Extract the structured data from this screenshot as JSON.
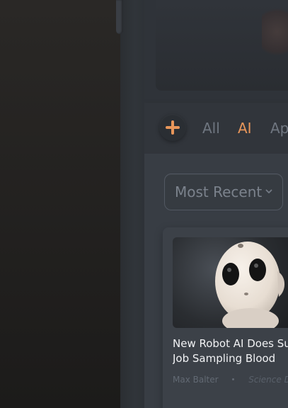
{
  "tabs": {
    "items": [
      {
        "label": "All",
        "active": false
      },
      {
        "label": "AI",
        "active": true
      },
      {
        "label": "Ap",
        "active": false
      }
    ],
    "accent_color": "#e8965a"
  },
  "sort": {
    "selected": "Most Recent"
  },
  "card": {
    "title_line1": "New Robot AI Does Sup",
    "title_line2": "Job Sampling Blood",
    "author": "Max Balter",
    "source": "Science Do"
  },
  "icons": {
    "add": "plus-icon",
    "sort_chevron": "chevron-down-icon"
  }
}
